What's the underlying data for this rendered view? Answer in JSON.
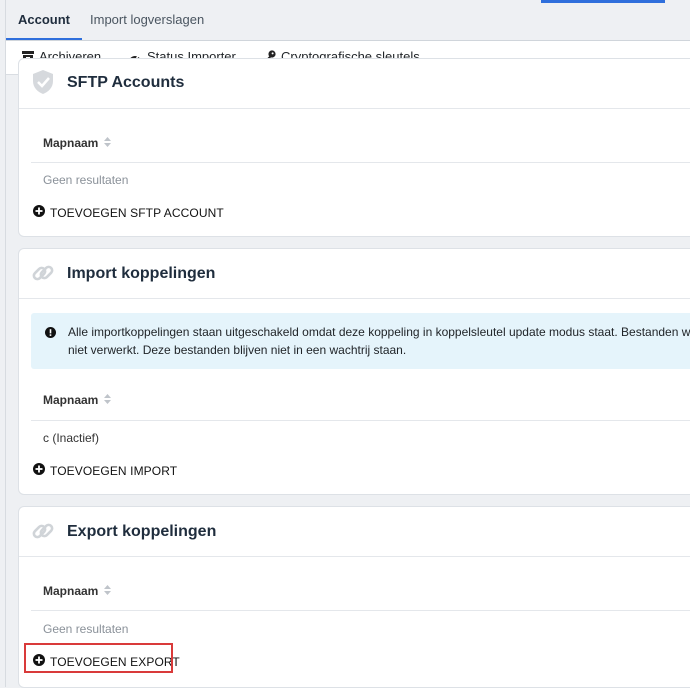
{
  "tabs": [
    {
      "label": "Account"
    },
    {
      "label": "Import logverslagen"
    }
  ],
  "toolbar": {
    "archive_label": "Archiveren",
    "status_label": "Status Importer",
    "crypto_label": "Cryptografische sleutels"
  },
  "sftp": {
    "title": "SFTP Accounts",
    "column": "Mapnaam",
    "empty": "Geen resultaten",
    "add_label": "TOEVOEGEN SFTP ACCOUNT"
  },
  "import": {
    "title": "Import koppelingen",
    "alert": "Alle importkoppelingen staan uitgeschakeld omdat deze koppeling in koppelsleutel update modus staat. Bestanden worden niet verwerkt. Deze bestanden blijven niet in een wachtrij staan.",
    "column": "Mapnaam",
    "row": "c (Inactief)",
    "add_label": "TOEVOEGEN IMPORT"
  },
  "export": {
    "title": "Export koppelingen",
    "column": "Mapnaam",
    "empty": "Geen resultaten",
    "add_label": "TOEVOEGEN EXPORT"
  },
  "colors": {
    "accent": "#2f6fdc",
    "alert_bg": "#e5f4fb",
    "highlight": "#d93a3a"
  }
}
